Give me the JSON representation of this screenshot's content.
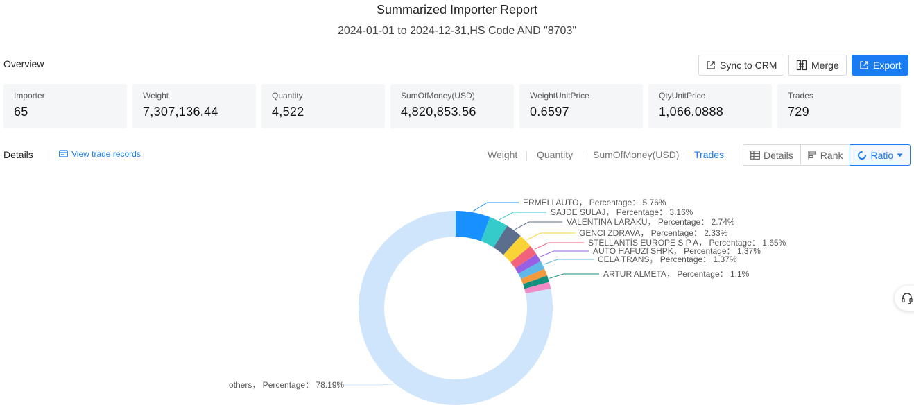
{
  "header": {
    "title": "Summarized Importer Report",
    "subtitle": "2024-01-01 to 2024-12-31,HS Code AND \"8703\""
  },
  "overview": {
    "label": "Overview",
    "buttons": {
      "sync": "Sync to CRM",
      "merge": "Merge",
      "export": "Export"
    },
    "stats": [
      {
        "label": "Importer",
        "value": "65"
      },
      {
        "label": "Weight",
        "value": "7,307,136.44"
      },
      {
        "label": "Quantity",
        "value": "4,522"
      },
      {
        "label": "SumOfMoney(USD)",
        "value": "4,820,853.56"
      },
      {
        "label": "WeightUnitPrice",
        "value": "0.6597"
      },
      {
        "label": "QtyUnitPrice",
        "value": "1,066.0888"
      },
      {
        "label": "Trades",
        "value": "729"
      }
    ]
  },
  "details": {
    "label": "Details",
    "view_records": "View trade records",
    "metric_tabs": [
      "Weight",
      "Quantity",
      "SumOfMoney(USD)",
      "Trades"
    ],
    "active_metric": "Trades",
    "views": {
      "details": "Details",
      "rank": "Rank",
      "ratio": "Ratio"
    }
  },
  "chart_data": {
    "type": "pie",
    "variant": "donut",
    "series": [
      {
        "name": "ERMELI AUTO",
        "label": "ERMELI AUTO， Percentage： 5.76%",
        "value": 5.76,
        "color": "#1890ff"
      },
      {
        "name": "SAJDE SULAJ",
        "label": "SAJDE SULAJ， Percentage： 3.16%",
        "value": 3.16,
        "color": "#36cbcb"
      },
      {
        "name": "VALENTINA LARAKU",
        "label": "VALENTINA LARAKU， Percentage： 2.74%",
        "value": 2.74,
        "color": "#5b6e8e"
      },
      {
        "name": "GENCI ZDRAVA",
        "label": "GENCI ZDRAVA， Percentage： 2.33%",
        "value": 2.33,
        "color": "#fad337"
      },
      {
        "name": "STELLANTIS EUROPE S P A",
        "label": "STELLANTİS EUROPE S P A， Percentage： 1.65%",
        "value": 1.65,
        "color": "#f2637b"
      },
      {
        "name": "AUTO HAFUZI SHPK",
        "label": "AUTO HAFUZI SHPK， Percentage： 1.37%",
        "value": 1.37,
        "color": "#975fe4"
      },
      {
        "name": "CELA TRANS",
        "label": "CELA TRANS， Percentage： 1.37%",
        "value": 1.37,
        "color": "#5fb8e8"
      },
      {
        "name": "unlabeled-1",
        "label": "",
        "value": 1.2,
        "color": "#f59a3c"
      },
      {
        "name": "ARTUR ALMETA",
        "label": "ARTUR ALMETA， Percentage： 1.1%",
        "value": 1.1,
        "color": "#138f7e"
      },
      {
        "name": "unlabeled-2",
        "label": "",
        "value": 1.1,
        "color": "#f08bc8"
      },
      {
        "name": "others",
        "label": "others， Percentage： 78.19%",
        "value": 78.19,
        "color": "#cfe5fb"
      }
    ],
    "legend": "none"
  }
}
